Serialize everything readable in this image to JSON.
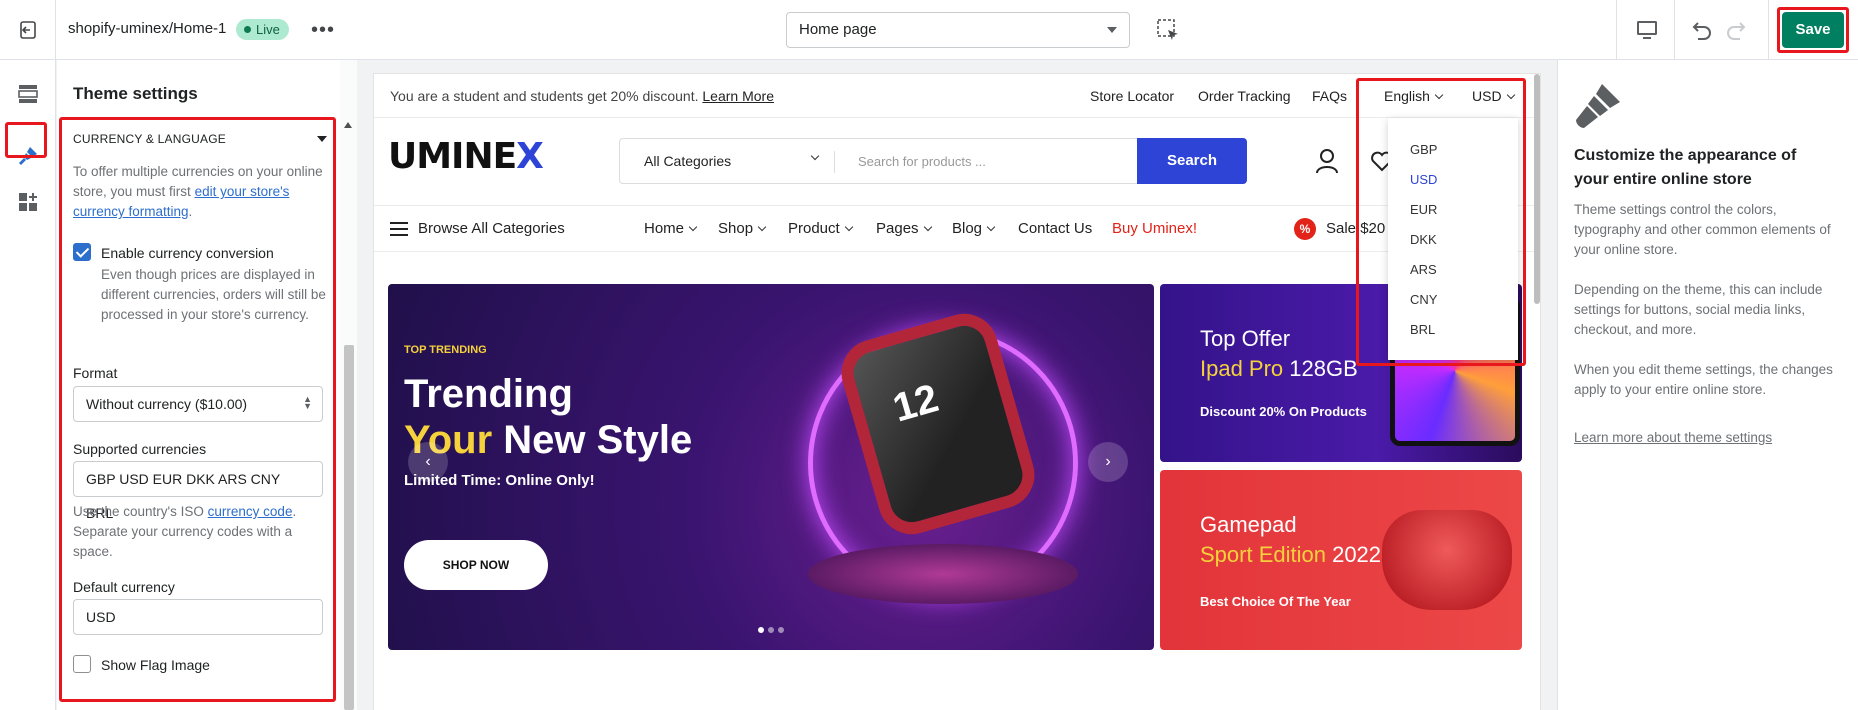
{
  "topbar": {
    "store_name": "shopify-uminex/Home-1",
    "live_label": "Live",
    "more_label": "•••",
    "page_select": "Home page",
    "save_label": "Save"
  },
  "left_panel": {
    "title": "Theme settings",
    "section_title": "CURRENCY & LANGUAGE",
    "desc_text": "To offer multiple currencies on your online store, you must first",
    "desc_link": "edit your store's currency formatting",
    "desc_end": ".",
    "enable_label": "Enable currency conversion",
    "enable_checked": true,
    "enable_help": "Even though prices are displayed in different currencies, orders will still be processed in your store's currency.",
    "format_label": "Format",
    "format_value": "Without currency ($10.00)",
    "supported_label": "Supported currencies",
    "supported_value": "GBP USD EUR  DKK ARS CNY BRL",
    "supported_help_1": "Use the country's ISO",
    "supported_help_link": "currency code",
    "supported_help_2": ". Separate your currency codes with a space.",
    "default_label": "Default currency",
    "default_value": "USD",
    "flag_label": "Show Flag Image",
    "flag_checked": false
  },
  "preview": {
    "promo_text": "You are a student and students get 20% discount.",
    "promo_link": "Learn More",
    "top_links": [
      "Store Locator",
      "Order Tracking",
      "FAQs"
    ],
    "language": "English",
    "currency": "USD",
    "currency_options": [
      "GBP",
      "USD",
      "EUR",
      "DKK",
      "ARS",
      "CNY",
      "BRL"
    ],
    "selected_currency": "USD",
    "logo_main": "UMINE",
    "logo_x": "X",
    "search_category": "All Categories",
    "search_placeholder": "Search for products ...",
    "search_button": "Search",
    "browse_label": "Browse All Categories",
    "nav": {
      "home": "Home",
      "shop": "Shop",
      "product": "Product",
      "pages": "Pages",
      "blog": "Blog",
      "contact": "Contact Us",
      "buy": "Buy Uminex!",
      "sale": "Sale $20"
    },
    "hero": {
      "eyebrow": "TOP TRENDING",
      "line1": "Trending",
      "line2_yellow": "Your",
      "line2_rest": " New Style",
      "sub": "Limited Time: Online Only!",
      "button": "SHOP NOW",
      "watch_text": "12"
    },
    "offer1": {
      "line1": "Top Offer",
      "line2_yellow": "Ipad Pro",
      "line2_rest": " 128GB",
      "sub": "Discount 20% On Products"
    },
    "offer2": {
      "line1": "Gamepad",
      "line2_yellow": "Sport Edition",
      "line2_rest": " 2022",
      "sub": "Best Choice Of The Year"
    }
  },
  "right_panel": {
    "title": "Customize the appearance of your entire online store",
    "p1": "Theme settings control the colors, typography and other common elements of your online store.",
    "p2": "Depending on the theme, this can include settings for buttons, social media links, checkout, and more.",
    "p3": "When you edit theme settings, the changes apply to your entire online store.",
    "link": "Learn more about theme settings"
  },
  "colors": {
    "save_green": "#008060",
    "highlight_red": "#e8161d",
    "brand_blue": "#2e44d6",
    "link_blue": "#2c6ecb"
  }
}
